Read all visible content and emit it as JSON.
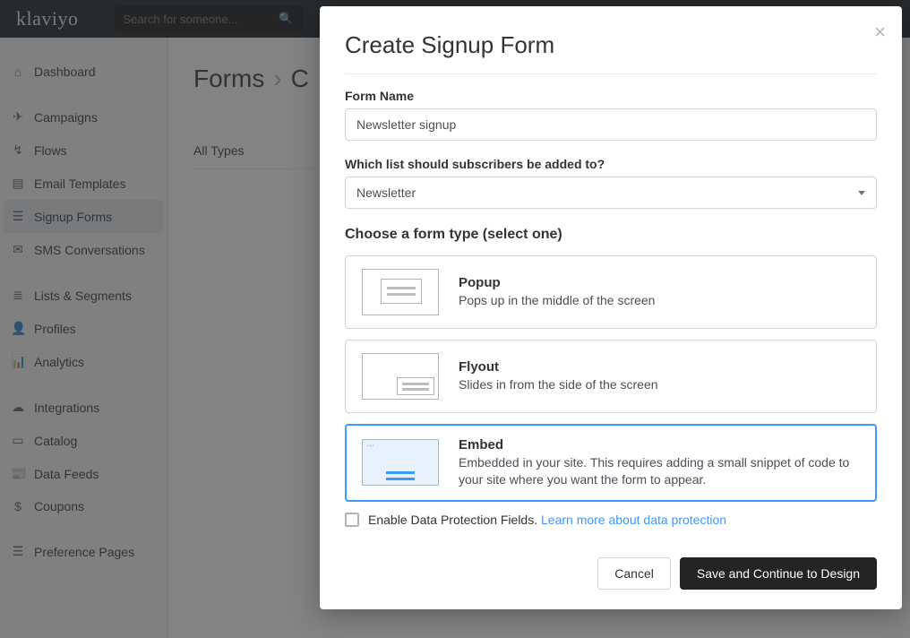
{
  "brand": "klaviyo",
  "search": {
    "placeholder": "Search for someone..."
  },
  "sidebar": {
    "items": [
      {
        "label": "Dashboard",
        "icon": "home-icon",
        "glyph": "⌂"
      },
      {
        "label": "Campaigns",
        "icon": "send-icon",
        "glyph": "✈"
      },
      {
        "label": "Flows",
        "icon": "flow-icon",
        "glyph": "↯"
      },
      {
        "label": "Email Templates",
        "icon": "template-icon",
        "glyph": "▤"
      },
      {
        "label": "Signup Forms",
        "icon": "form-icon",
        "glyph": "☰"
      },
      {
        "label": "SMS Conversations",
        "icon": "sms-icon",
        "glyph": "✉"
      },
      {
        "label": "Lists & Segments",
        "icon": "lists-icon",
        "glyph": "≣"
      },
      {
        "label": "Profiles",
        "icon": "profile-icon",
        "glyph": "👤"
      },
      {
        "label": "Analytics",
        "icon": "analytics-icon",
        "glyph": "📊"
      },
      {
        "label": "Integrations",
        "icon": "integrations-icon",
        "glyph": "☁"
      },
      {
        "label": "Catalog",
        "icon": "catalog-icon",
        "glyph": "▭"
      },
      {
        "label": "Data Feeds",
        "icon": "feed-icon",
        "glyph": "📰"
      },
      {
        "label": "Coupons",
        "icon": "coupons-icon",
        "glyph": "$"
      },
      {
        "label": "Preference Pages",
        "icon": "prefs-icon",
        "glyph": "☰"
      }
    ],
    "active_index": 4
  },
  "breadcrumb": {
    "root": "Forms",
    "current": "C"
  },
  "filter": {
    "tab0": "All Types"
  },
  "modal": {
    "title": "Create Signup Form",
    "form_name_label": "Form Name",
    "form_name_value": "Newsletter signup",
    "list_label": "Which list should subscribers be added to?",
    "list_value": "Newsletter",
    "type_label": "Choose a form type (select one)",
    "types": [
      {
        "title": "Popup",
        "desc": "Pops up in the middle of the screen"
      },
      {
        "title": "Flyout",
        "desc": "Slides in from the side of the screen"
      },
      {
        "title": "Embed",
        "desc": "Embedded in your site. This requires adding a small snippet of code to your site where you want the form to appear."
      }
    ],
    "selected_type_index": 2,
    "checkbox": {
      "text": "Enable Data Protection Fields. ",
      "link": "Learn more about data protection"
    },
    "cancel": "Cancel",
    "save": "Save and Continue to Design"
  }
}
